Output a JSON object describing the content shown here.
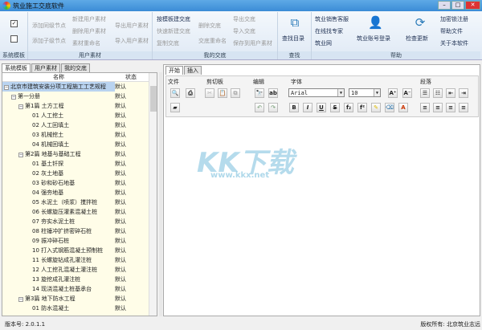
{
  "window": {
    "title": "筑业施工交底软件",
    "min": "–",
    "max": "□",
    "close": "✕"
  },
  "ribbon": {
    "system": {
      "label": "系统模板"
    },
    "user_material": {
      "label": "用户素材",
      "items": [
        "添加同级节点",
        "添加子级节点",
        "新建用户素材",
        "删除用户素材",
        "素材重命名",
        "导出用户素材",
        "导入用户素材"
      ]
    },
    "my_disclosure": {
      "label": "我的交底",
      "items": [
        "按模板建交底",
        "快速新建交底",
        "复制交底",
        "删除交底",
        "交底重命名",
        "导出交底",
        "导入交底",
        "保存到用户素材"
      ]
    },
    "find": {
      "label": "查找",
      "button": "查找目录"
    },
    "help": {
      "label": "帮助",
      "items": [
        "筑业销售客服",
        "在线找专家",
        "筑业网"
      ],
      "login": "筑业账号登录",
      "update": "检查更新",
      "links": [
        "加密锁注册",
        "帮助文件",
        "关于本软件"
      ]
    }
  },
  "left": {
    "tabs": [
      "系统模板",
      "用户素材",
      "我的交底"
    ],
    "columns": [
      "名称",
      "状态"
    ],
    "rows": [
      {
        "name": "北京市建筑安装分项工程施工工艺规程",
        "status": "默认"
      },
      {
        "name": "第一分册",
        "status": "默认"
      },
      {
        "name": "第1篇 土方工程",
        "status": "默认"
      },
      {
        "name": "01 人工挖土",
        "status": "默认"
      },
      {
        "name": "02 人工回填土",
        "status": "默认"
      },
      {
        "name": "03 机械挖土",
        "status": "默认"
      },
      {
        "name": "04 机械回填土",
        "status": "默认"
      },
      {
        "name": "第2篇 地基与基础工程",
        "status": "默认"
      },
      {
        "name": "01 基土钎探",
        "status": "默认"
      },
      {
        "name": "02 灰土地基",
        "status": "默认"
      },
      {
        "name": "03 砂和砂石地基",
        "status": "默认"
      },
      {
        "name": "04 强夯地基",
        "status": "默认"
      },
      {
        "name": "05 水泥土（喷浆）搅拌桩",
        "status": "默认"
      },
      {
        "name": "06 长螺旋压灌素混凝土桩",
        "status": "默认"
      },
      {
        "name": "07 夯实水泥土桩",
        "status": "默认"
      },
      {
        "name": "08 柱锤冲扩挤密碎石桩",
        "status": "默认"
      },
      {
        "name": "09 振冲碎石桩",
        "status": "默认"
      },
      {
        "name": "10 打入式钢筋混凝土预制桩",
        "status": "默认"
      },
      {
        "name": "11 长螺旋钻成孔灌注桩",
        "status": "默认"
      },
      {
        "name": "12 人工挖孔混凝土灌注桩",
        "status": "默认"
      },
      {
        "name": "13 旋挖成孔灌注桩",
        "status": "默认"
      },
      {
        "name": "14 现浇混凝土桩基承台",
        "status": "默认"
      },
      {
        "name": "第3篇 地下防水工程",
        "status": "默认"
      },
      {
        "name": "01 防水混凝土",
        "status": "默认"
      }
    ]
  },
  "editor": {
    "tabs": [
      "开始",
      "插入"
    ],
    "groups": [
      "文件",
      "剪切板",
      "编辑",
      "字体",
      "段落"
    ],
    "font": "Arial",
    "size": "10",
    "fmt": [
      "B",
      "I",
      "U",
      "S",
      "f₂",
      "f²"
    ]
  },
  "status": {
    "version": "版本号: 2.0.1.1",
    "copyright": "版权所有: 北京筑业志远"
  },
  "watermark": {
    "main": "KK下载",
    "url": "www.kkx.net"
  }
}
